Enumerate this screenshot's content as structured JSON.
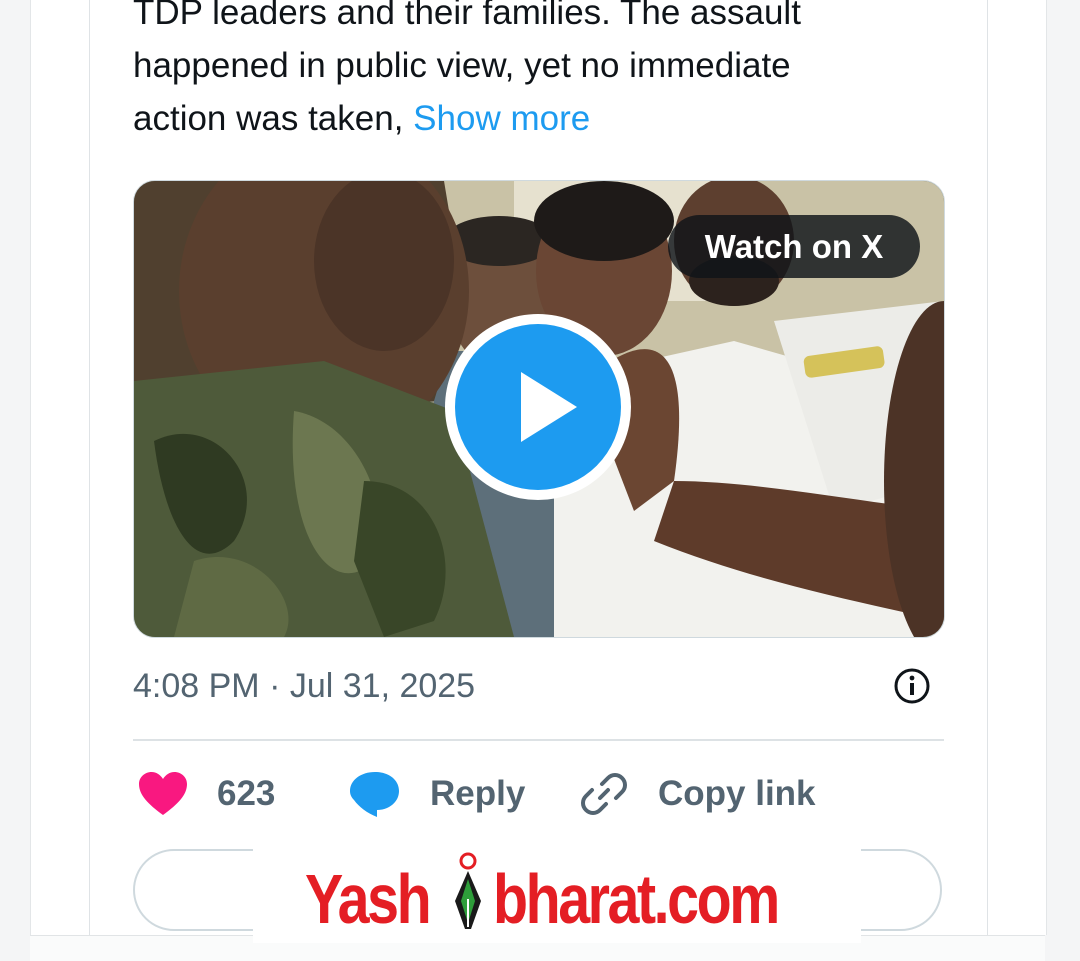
{
  "tweet": {
    "text_line1": "TDP leaders and their families. The assault",
    "text_line2": "happened in public view, yet no immediate",
    "text_line3_prefix": "action was taken,",
    "show_more_label": "Show more",
    "timestamp": "4:08 PM · Jul 31, 2025"
  },
  "media": {
    "watch_label": "Watch on X",
    "play_icon": "play-icon"
  },
  "actions": {
    "like_count": "623",
    "reply_label": "Reply",
    "copy_link_label": "Copy link"
  },
  "icons": [
    "heart-icon",
    "reply-bubble-icon",
    "link-icon",
    "info-icon"
  ],
  "watermark": {
    "left": "Yash",
    "right": "bharat.com",
    "logo_caption": "Yashbharat"
  },
  "colors": {
    "accent": "#1d9bf0",
    "like": "#f91880",
    "text": "#0f1419",
    "secondary": "#536471",
    "watermark": "#e41e24"
  }
}
